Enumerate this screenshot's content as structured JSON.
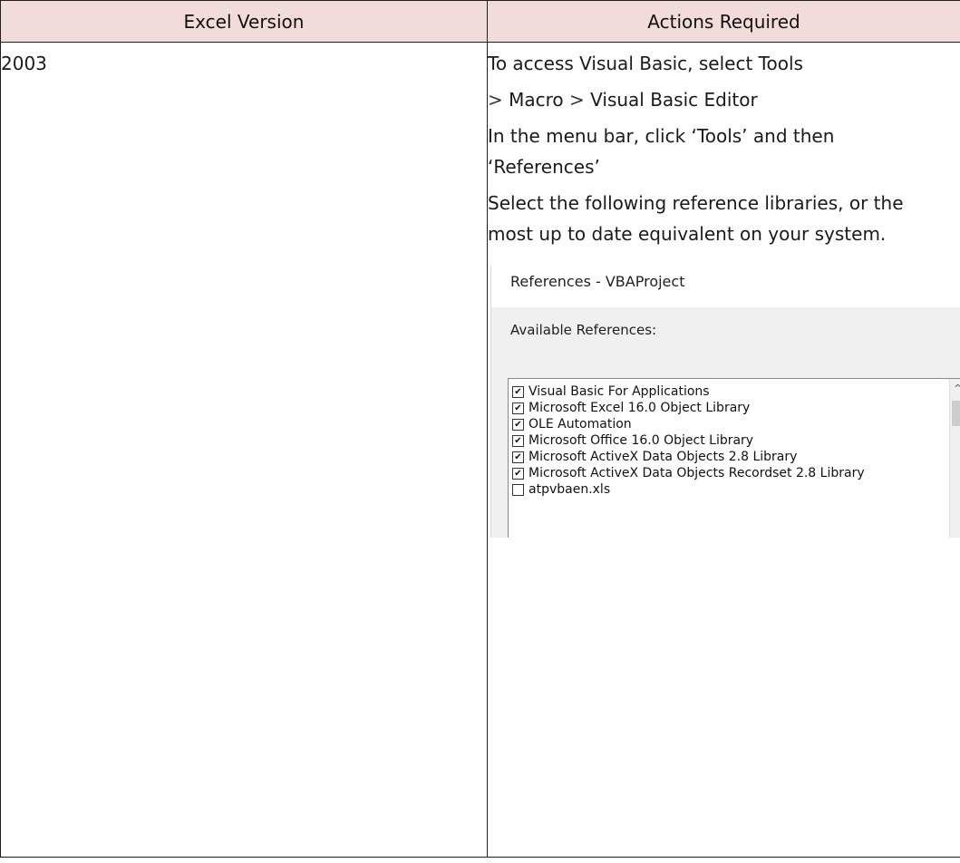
{
  "table": {
    "headers": [
      "Excel Version",
      "Actions Required"
    ],
    "version": "2003",
    "actions": {
      "line1": "To access Visual Basic, select Tools",
      "line2_gt1": ">",
      "line2_part1": "Macro",
      "line2_gt2": ">",
      "line2_part2": "Visual Basic Editor",
      "line3": "In the menu bar, click ‘Tools’ and then",
      "line4": "‘References’",
      "line5": "Select the following reference libraries, or the",
      "line6": "most up to date equivalent on your system."
    }
  },
  "dialog": {
    "title": "References - VBAProject",
    "available_label": "Available References:",
    "references": [
      {
        "label": "Visual Basic For Applications",
        "checked": true
      },
      {
        "label": "Microsoft Excel 16.0 Object Library",
        "checked": true
      },
      {
        "label": "OLE Automation",
        "checked": true
      },
      {
        "label": "Microsoft Office 16.0 Object Library",
        "checked": true
      },
      {
        "label": "Microsoft ActiveX Data Objects 2.8 Library",
        "checked": true
      },
      {
        "label": "Microsoft ActiveX Data Objects Recordset 2.8 Library",
        "checked": true
      },
      {
        "label": "atpvbaen.xls",
        "checked": false
      }
    ],
    "scroll_up_icon": "chevron-up-icon",
    "check_icon": "checkmark-icon"
  },
  "colors": {
    "header_bg": "#f2dbdb",
    "border": "#1f1f1f",
    "dialog_bg": "#f0f0f0"
  }
}
